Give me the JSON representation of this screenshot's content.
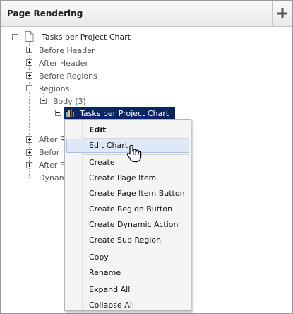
{
  "panel": {
    "title": "Page Rendering",
    "add_label": "+"
  },
  "tree": {
    "root": "Tasks per Project Chart",
    "before_header": "Before Header",
    "after_header": "After Header",
    "before_regions": "Before Regions",
    "regions": "Regions",
    "body": "Body (3)",
    "selected": "Tasks per Project Chart",
    "after_regions_partial": "After R",
    "before_footer_partial": "Befor",
    "after_footer_partial": "After F",
    "dynamic_partial": "Dynam"
  },
  "context_menu": {
    "edit": "Edit",
    "edit_chart": "Edit Chart",
    "create": "Create",
    "create_page_item": "Create Page Item",
    "create_page_item_button": "Create Page Item Button",
    "create_region_button": "Create Region Button",
    "create_dynamic_action": "Create Dynamic Action",
    "create_sub_region": "Create Sub Region",
    "copy": "Copy",
    "rename": "Rename",
    "expand_all": "Expand All",
    "collapse_all": "Collapse All"
  },
  "colors": {
    "selection": "#0a246a",
    "menu_hover": "#dfe8f6"
  },
  "icons": [
    "plus-icon",
    "page-icon",
    "chart-icon",
    "hand-pointer-cursor"
  ]
}
